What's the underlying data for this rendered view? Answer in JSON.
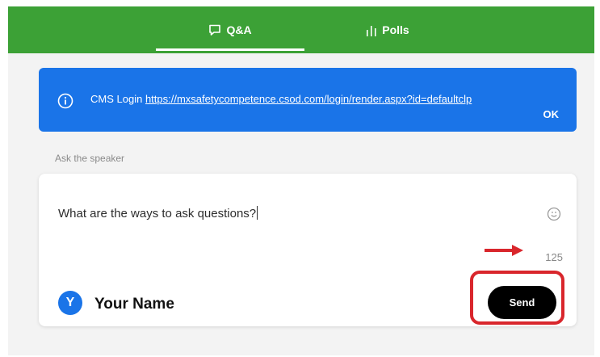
{
  "tabs": [
    {
      "label": "Q&A",
      "icon": "chat-bubble-icon",
      "active": true
    },
    {
      "label": "Polls",
      "icon": "bar-chart-icon",
      "active": false
    }
  ],
  "banner": {
    "label": "CMS Login",
    "link_text": "https://mxsafetycompetence.csod.com/login/render.aspx?id=defaultclp",
    "ok_label": "OK",
    "icon": "info-icon",
    "background": "#1a74e8"
  },
  "ask": {
    "label": "Ask the speaker",
    "question_text": "What are the ways to ask questions?",
    "char_count": "125",
    "emoji_icon": "smiley-icon"
  },
  "user": {
    "avatar_initial": "Y",
    "name": "Your Name"
  },
  "send_label": "Send",
  "colors": {
    "header_green": "#3ca136",
    "accent_blue": "#1a74e8",
    "highlight_red": "#d9262c"
  }
}
